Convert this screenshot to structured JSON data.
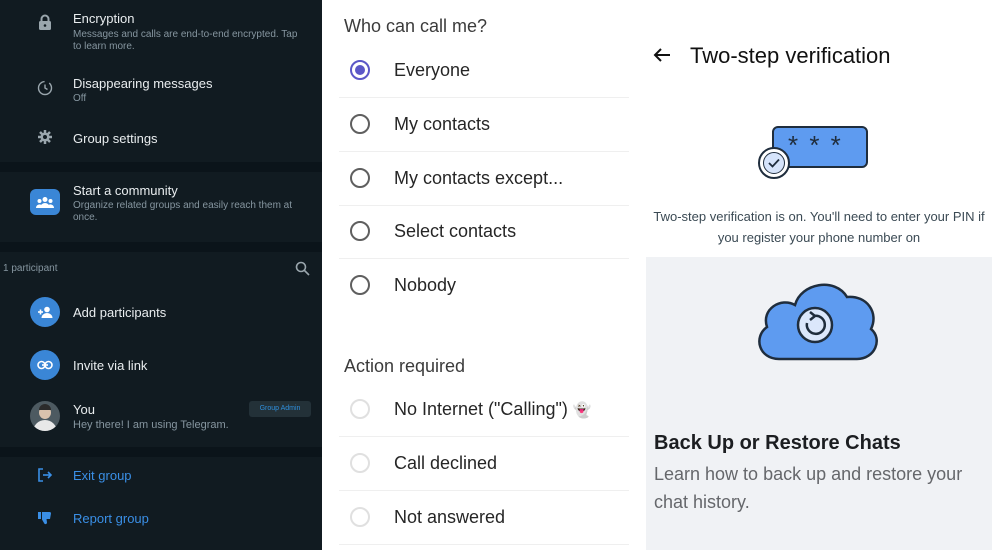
{
  "left": {
    "encryption": {
      "title": "Encryption",
      "subtitle": "Messages and calls are end-to-end encrypted. Tap to learn more.",
      "icon": "lock-icon"
    },
    "disappearing": {
      "title": "Disappearing messages",
      "subtitle": "Off",
      "icon": "timer-icon"
    },
    "group_settings": {
      "title": "Group settings",
      "icon": "gear-icon"
    },
    "community": {
      "title": "Start a community",
      "subtitle": "Organize related groups and easily reach them at once.",
      "icon": "community-icon"
    },
    "participants_count": "1 participant",
    "add_participants": "Add participants",
    "invite_link": "Invite via link",
    "member": {
      "name": "You",
      "status": "Hey there! I am using Telegram.",
      "badge": "Group Admin"
    },
    "exit_group": "Exit group",
    "report_group": "Report group",
    "colors": {
      "background": "#111b21",
      "accent": "#3a86d6",
      "danger_text": "#3a8fe6"
    }
  },
  "middle": {
    "heading": "Who can call me?",
    "options": [
      {
        "label": "Everyone",
        "selected": true
      },
      {
        "label": "My contacts",
        "selected": false
      },
      {
        "label": "My contacts except...",
        "selected": false
      },
      {
        "label": "Select contacts",
        "selected": false
      },
      {
        "label": "Nobody",
        "selected": false
      }
    ],
    "action_heading": "Action required",
    "actions": [
      {
        "label": "No Internet (\"Calling\")",
        "emoji": "👻"
      },
      {
        "label": "Call declined"
      },
      {
        "label": "Not answered"
      }
    ],
    "colors": {
      "accent": "#5b57c7"
    }
  },
  "right": {
    "back_icon": "arrow-left-icon",
    "title": "Two-step verification",
    "pin_graphic_text": "* * *",
    "description": "Two-step verification is on. You'll need to enter your PIN if you register your phone number on",
    "backup_title": "Back Up or Restore Chats",
    "backup_desc": "Learn how to back up and restore your chat history.",
    "colors": {
      "illustration_blue": "#5e9bf0",
      "panel_gray": "#f0f2f5"
    }
  }
}
